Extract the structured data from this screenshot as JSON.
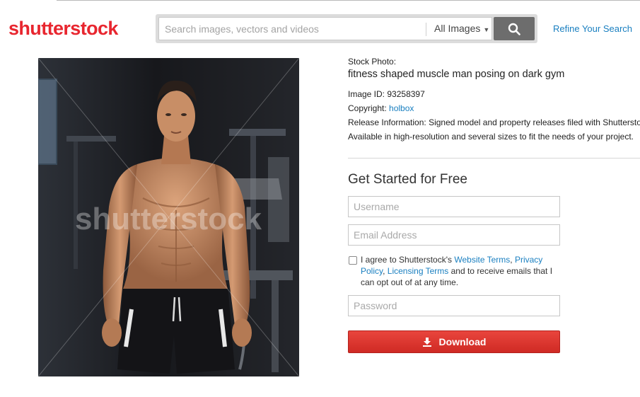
{
  "header": {
    "logo_text": "shutterstock",
    "search_placeholder": "Search images, vectors and videos",
    "search_type_selected": "All Images",
    "search_button_icon": "search-icon",
    "refine_link": "Refine Your Search"
  },
  "image": {
    "watermark": "shutterstock",
    "description": "fitness shaped muscle man posing on dark gym"
  },
  "details": {
    "type_label": "Stock Photo:",
    "title": "fitness shaped muscle man posing on dark gym",
    "image_id_label": "Image ID:",
    "image_id": "93258397",
    "copyright_label": "Copyright:",
    "copyright_author": "holbox",
    "release_label": "Release Information:",
    "release_text": "Signed model and property releases filed with Shutterstock, Inc.",
    "availability": "Available in high-resolution and several sizes to fit the needs of your project."
  },
  "signup": {
    "title": "Get Started for Free",
    "username_placeholder": "Username",
    "email_placeholder": "Email Address",
    "agree_prefix": "I agree to Shutterstock's ",
    "website_terms": "Website Terms",
    "comma": ", ",
    "privacy_policy": "Privacy Policy",
    "licensing_terms": "Licensing Terms",
    "agree_suffix": " and to receive emails that I can opt out of at any time.",
    "password_placeholder": "Password",
    "download_button": "Download",
    "download_icon": "download-icon"
  },
  "colors": {
    "brand_red": "#e8262f",
    "link_blue": "#197fc0",
    "button_red": "#d83029",
    "search_button_gray": "#6d6d6d"
  }
}
